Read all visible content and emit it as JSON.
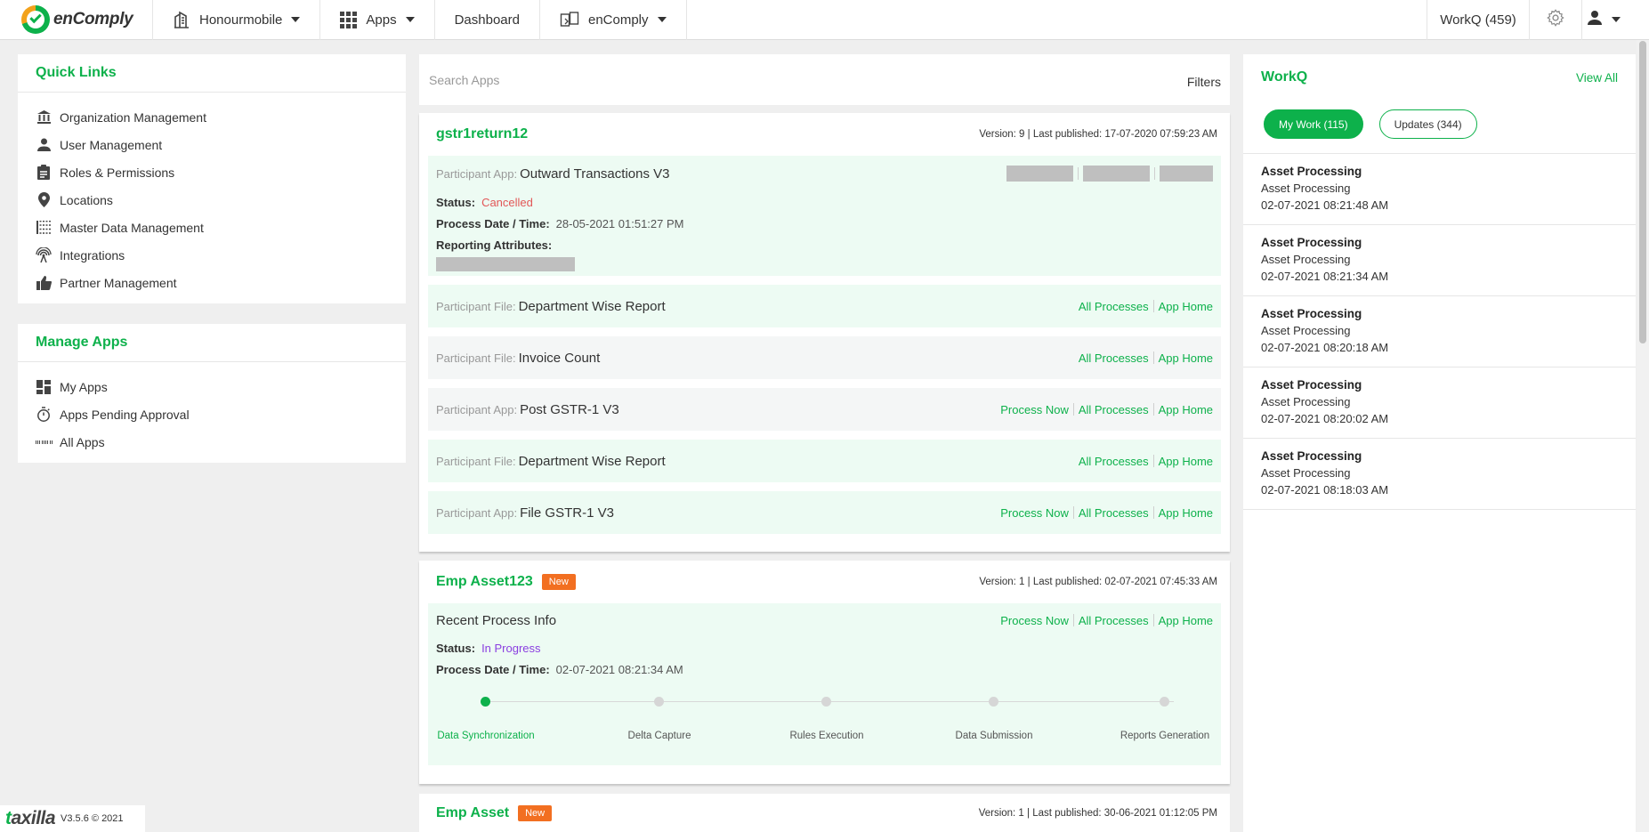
{
  "nav": {
    "brand": "enComply",
    "org": "Honourmobile",
    "apps": "Apps",
    "dashboard": "Dashboard",
    "product": "enComply",
    "workq": "WorkQ (459)"
  },
  "quick_links": {
    "title": "Quick Links",
    "items": [
      {
        "label": "Organization Management",
        "icon": "bank-icon"
      },
      {
        "label": "User Management",
        "icon": "user-icon"
      },
      {
        "label": "Roles & Permissions",
        "icon": "clipboard-icon"
      },
      {
        "label": "Locations",
        "icon": "location-pin-icon"
      },
      {
        "label": "Master Data Management",
        "icon": "data-table-icon"
      },
      {
        "label": "Integrations",
        "icon": "antenna-icon"
      },
      {
        "label": "Partner Management",
        "icon": "thumbs-up-icon"
      }
    ]
  },
  "manage_apps": {
    "title": "Manage Apps",
    "items": [
      {
        "label": "My Apps",
        "icon": "dashboard-icon"
      },
      {
        "label": "Apps Pending Approval",
        "icon": "timer-icon"
      },
      {
        "label": "All Apps",
        "icon": "apps-grid-icon"
      }
    ]
  },
  "search": {
    "placeholder": "Search Apps",
    "filters": "Filters"
  },
  "actions": {
    "process_now": "Process Now",
    "all_processes": "All Processes",
    "app_home": "App Home"
  },
  "labels": {
    "participant_app": "Participant App:",
    "participant_file": "Participant File:",
    "status": "Status:",
    "process_datetime": "Process Date / Time:",
    "reporting_attributes": "Reporting Attributes:",
    "recent_process_info": "Recent Process Info",
    "new_badge": "New"
  },
  "cards": [
    {
      "title": "gstr1return12",
      "version": "Version: 9 | Last published: 17-07-2020 07:59:23 AM",
      "main": {
        "participant_app": "Outward Transactions V3",
        "status": "Cancelled",
        "process_datetime": "28-05-2021 01:51:27 PM"
      },
      "rows": [
        {
          "label_type": "Participant File:",
          "name": "Department Wise Report"
        },
        {
          "label_type": "Participant File:",
          "name": "Invoice Count"
        },
        {
          "label_type": "Participant App:",
          "name": "Post GSTR-1 V3"
        },
        {
          "label_type": "Participant File:",
          "name": "Department Wise Report"
        },
        {
          "label_type": "Participant App:",
          "name": "File GSTR-1 V3"
        }
      ]
    },
    {
      "title": "Emp Asset123",
      "version": "Version: 1 | Last published: 02-07-2021 07:45:33 AM",
      "status": "In Progress",
      "process_datetime": "02-07-2021 08:21:34 AM",
      "steps": [
        "Data Synchronization",
        "Delta Capture",
        "Rules Execution",
        "Data Submission",
        "Reports Generation"
      ],
      "current_step": 1
    },
    {
      "title": "Emp Asset",
      "version": "Version: 1 | Last published: 30-06-2021 01:12:05 PM"
    }
  ],
  "workq": {
    "title": "WorkQ",
    "view_all": "View All",
    "tab_mywork": "My Work (115)",
    "tab_updates": "Updates (344)",
    "items": [
      {
        "title": "Asset Processing",
        "subtitle": "Asset Processing",
        "time": "02-07-2021 08:21:48 AM"
      },
      {
        "title": "Asset Processing",
        "subtitle": "Asset Processing",
        "time": "02-07-2021 08:21:34 AM"
      },
      {
        "title": "Asset Processing",
        "subtitle": "Asset Processing",
        "time": "02-07-2021 08:20:18 AM"
      },
      {
        "title": "Asset Processing",
        "subtitle": "Asset Processing",
        "time": "02-07-2021 08:20:02 AM"
      },
      {
        "title": "Asset Processing",
        "subtitle": "Asset Processing",
        "time": "02-07-2021 08:18:03 AM"
      }
    ]
  },
  "footer": {
    "brand_t": "t",
    "brand_rest": "axilla",
    "version": "V3.5.6 © 2021"
  },
  "colors": {
    "accent": "#0db14b",
    "cancel": "#e25757",
    "progress": "#8a3fe0",
    "badge": "#f26f21"
  }
}
